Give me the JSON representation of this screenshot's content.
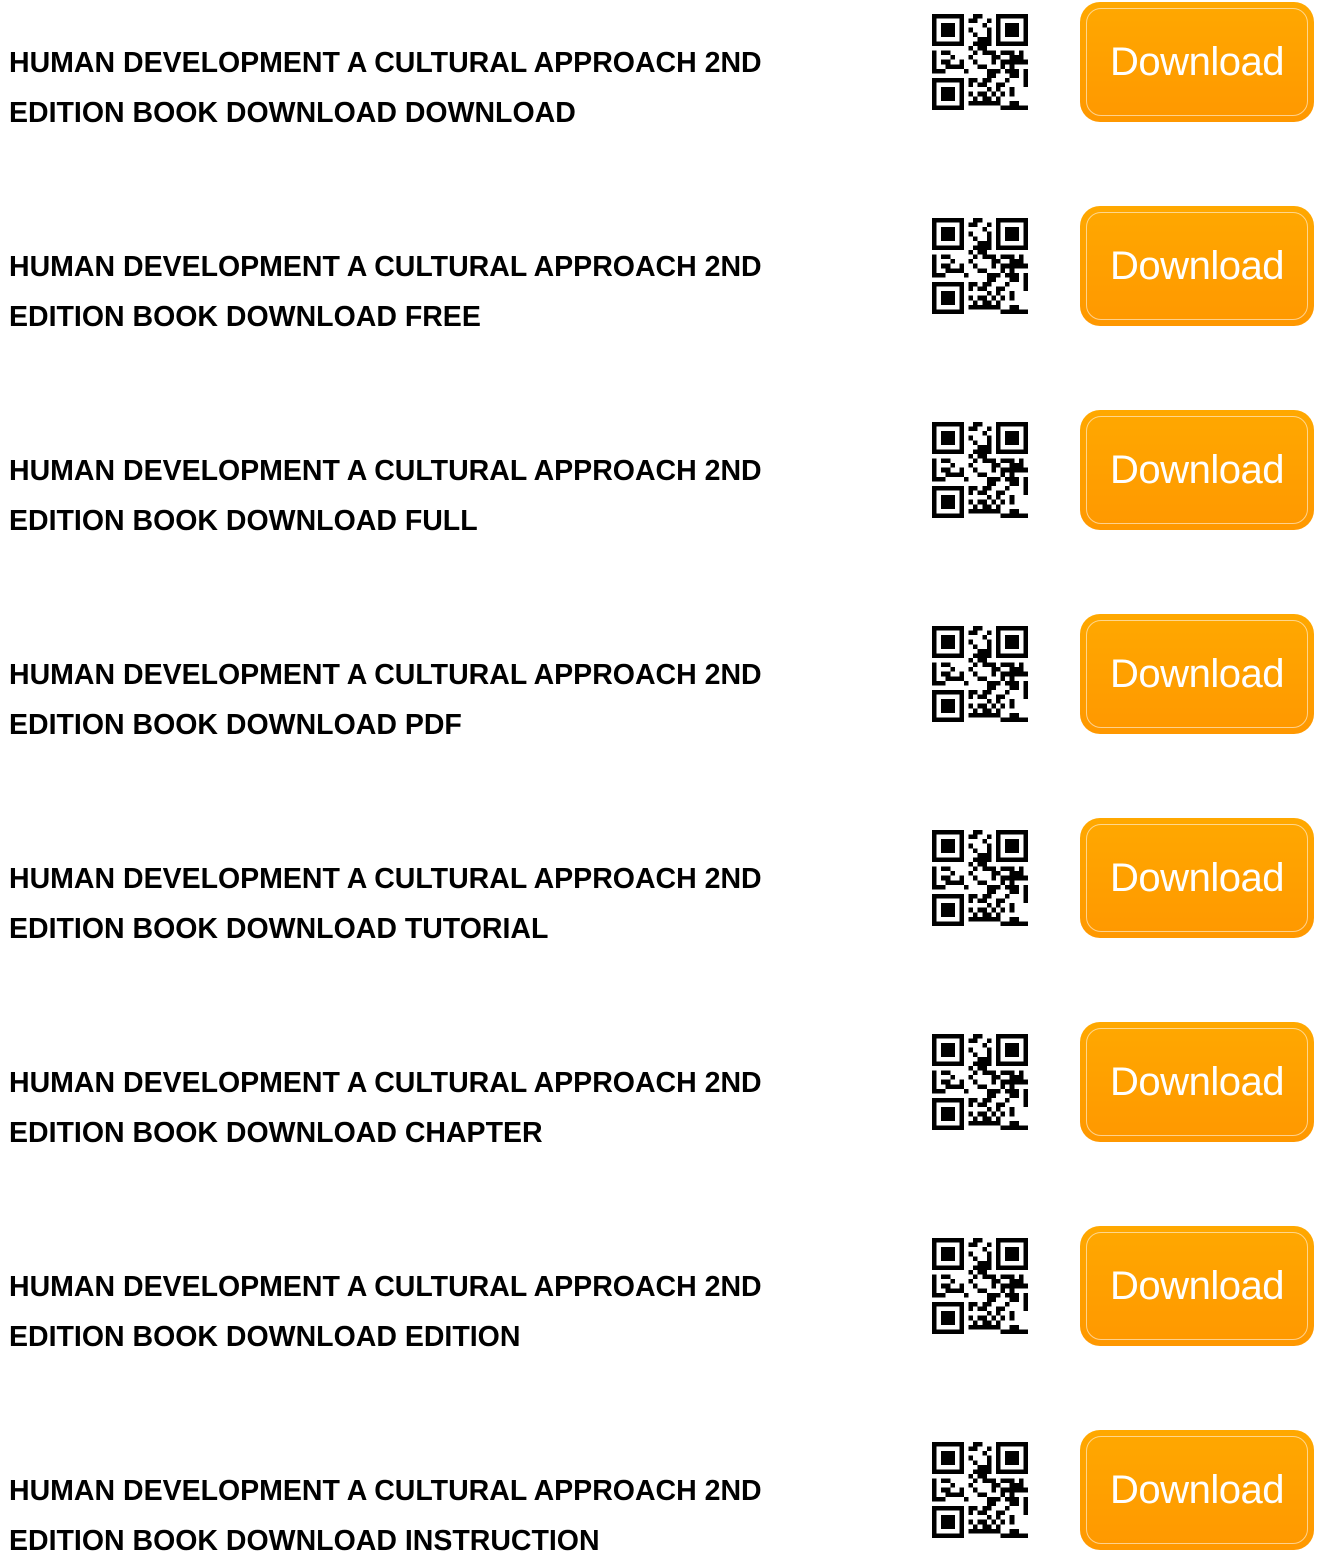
{
  "items": [
    {
      "line1": "HUMAN DEVELOPMENT A CULTURAL APPROACH 2ND",
      "line2": "EDITION BOOK DOWNLOAD DOWNLOAD",
      "button_label": "Download"
    },
    {
      "line1": "HUMAN DEVELOPMENT A CULTURAL APPROACH 2ND",
      "line2": "EDITION BOOK DOWNLOAD FREE",
      "button_label": "Download"
    },
    {
      "line1": "HUMAN DEVELOPMENT A CULTURAL APPROACH 2ND",
      "line2": "EDITION BOOK DOWNLOAD FULL",
      "button_label": "Download"
    },
    {
      "line1": "HUMAN DEVELOPMENT A CULTURAL APPROACH 2ND",
      "line2": "EDITION BOOK DOWNLOAD PDF",
      "button_label": "Download"
    },
    {
      "line1": "HUMAN DEVELOPMENT A CULTURAL APPROACH 2ND",
      "line2": "EDITION BOOK DOWNLOAD TUTORIAL",
      "button_label": "Download"
    },
    {
      "line1": "HUMAN DEVELOPMENT A CULTURAL APPROACH 2ND",
      "line2": "EDITION BOOK DOWNLOAD CHAPTER",
      "button_label": "Download"
    },
    {
      "line1": "HUMAN DEVELOPMENT A CULTURAL APPROACH 2ND",
      "line2": "EDITION BOOK DOWNLOAD EDITION",
      "button_label": "Download"
    },
    {
      "line1": "HUMAN DEVELOPMENT A CULTURAL APPROACH 2ND",
      "line2": "EDITION BOOK DOWNLOAD INSTRUCTION",
      "button_label": "Download"
    }
  ],
  "colors": {
    "button": "#ff9f00",
    "text": "#000000",
    "button_text": "#ffffff"
  },
  "icons": {
    "qr": "qr-code-icon"
  }
}
